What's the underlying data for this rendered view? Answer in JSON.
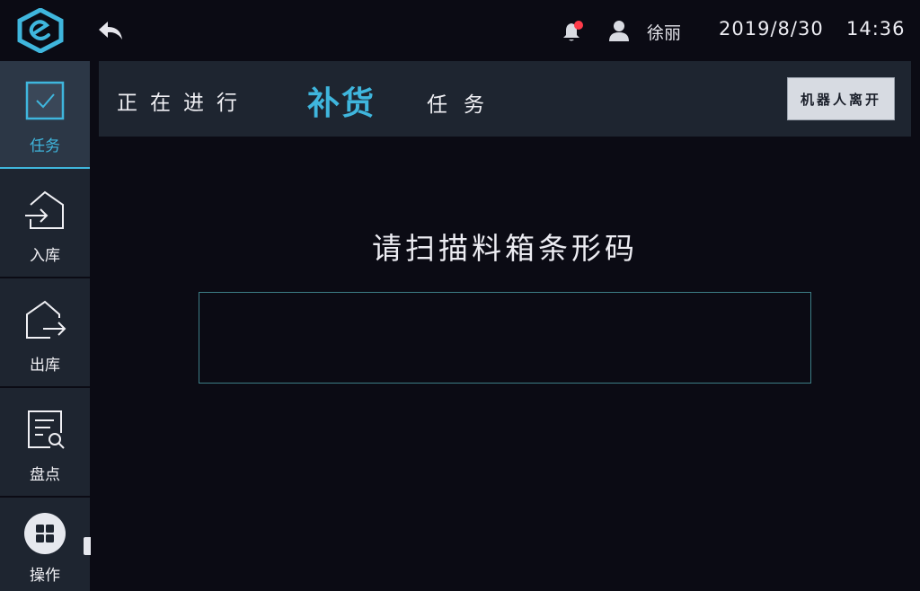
{
  "header": {
    "user_name": "徐丽",
    "date": "2019/8/30",
    "time": "14:36",
    "notification_dot_color": "#ff3b4a"
  },
  "sidebar": {
    "items": [
      {
        "label": "任务",
        "icon": "task-check-icon",
        "active": true
      },
      {
        "label": "入库",
        "icon": "inbound-icon",
        "active": false
      },
      {
        "label": "出库",
        "icon": "outbound-icon",
        "active": false
      },
      {
        "label": "盘点",
        "icon": "inventory-icon",
        "active": false
      },
      {
        "label": "操作",
        "icon": "grid-icon",
        "active": false
      }
    ]
  },
  "task": {
    "status_text": "正在进行",
    "task_type": "补货",
    "task_word": "任务",
    "leave_button_label": "机器人离开"
  },
  "scan": {
    "prompt": "请扫描料箱条形码",
    "input_value": ""
  },
  "colors": {
    "accent": "#3fb6dd",
    "background": "#0b0b14",
    "panel": "#1e2530",
    "active_nav": "#2c3746"
  }
}
